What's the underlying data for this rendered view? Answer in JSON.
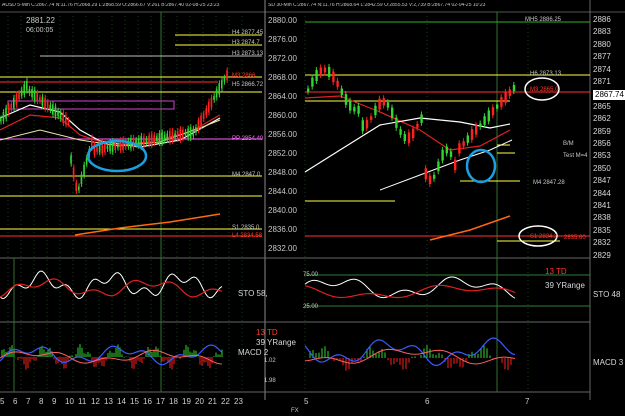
{
  "left_chart": {
    "header": "AUSD 5-Min C:2867.74 N:11.76 H:2868.29 L:2868.59 O:2866.67 V:261 B:2867.40 02-08-25 23:23",
    "price_line": "2881.22",
    "time_line": "06:00:05",
    "levels": {
      "h4": "H4 2877.45",
      "h3": "H3 2874.7",
      "h3b": "H3 2873.13",
      "h5": "H5 2866.72",
      "m3": "M3 2866",
      "m4": "M4 2847.0",
      "pp": "PP 2854.40",
      "s1": "S1 2835.0",
      "l4": "L4 2834.58"
    },
    "x_ticks": [
      "5",
      "6",
      "7",
      "8",
      "9",
      "10",
      "11",
      "12",
      "13",
      "14",
      "15",
      "16",
      "17",
      "18",
      "19",
      "20",
      "21",
      "22",
      "23"
    ],
    "sto_label": "STO  58,",
    "td_label": "13 TD",
    "range_label": "39 YRange",
    "macd_label": "MACD  2",
    "macd_val1": "1.02",
    "macd_val2": "1.98"
  },
  "right_chart": {
    "header": "SD 30-Min C:2867.74 N:11.76 H:2868.64 L:2842.59 O:2855.53 V:2,739 B:2867.74 02-04-25 10:23",
    "price_ticks": [
      "2880.00",
      "2876.00",
      "2872.00",
      "2868.00",
      "2864.00",
      "2860.00",
      "2856.00",
      "2852.00",
      "2848.00",
      "2844.00",
      "2840.00",
      "2836.00",
      "2832.00"
    ],
    "axis_ticks": [
      "2886",
      "2883",
      "2880",
      "2877",
      "2874",
      "2871",
      "2868",
      "2865",
      "2862",
      "2859",
      "2856",
      "2853",
      "2850",
      "2847",
      "2844",
      "2841",
      "2838",
      "2835",
      "2832",
      "2829"
    ],
    "current_price": "2867.74",
    "levels": {
      "mh5": "MH5 2886.25",
      "h6": "H6 2873.13",
      "m3": "M3 2865.0",
      "m4": "M4 2847.28",
      "bm": "B/M",
      "test_m": "Test M=4",
      "s1": "S1 2834.2",
      "s1_right": "2835.60"
    },
    "x_ticks": [
      "5",
      "6",
      "7"
    ],
    "x_sub": "FX",
    "sto_ticks": [
      "75.00",
      "25.00"
    ],
    "td_label": "13 TD",
    "range_label": "39 YRange",
    "sto_label": "STO  48",
    "macd_label": "MACD  3"
  },
  "colors": {
    "up": "#33d433",
    "down": "#ff2020",
    "level": "#ffff40",
    "circle": "#1a9fe0",
    "ma_red": "#e02020",
    "ma_white": "#ffffff",
    "ma_orange": "#ff6a10",
    "stoch": "#ffffff",
    "macd_blue": "#3a5cff"
  }
}
